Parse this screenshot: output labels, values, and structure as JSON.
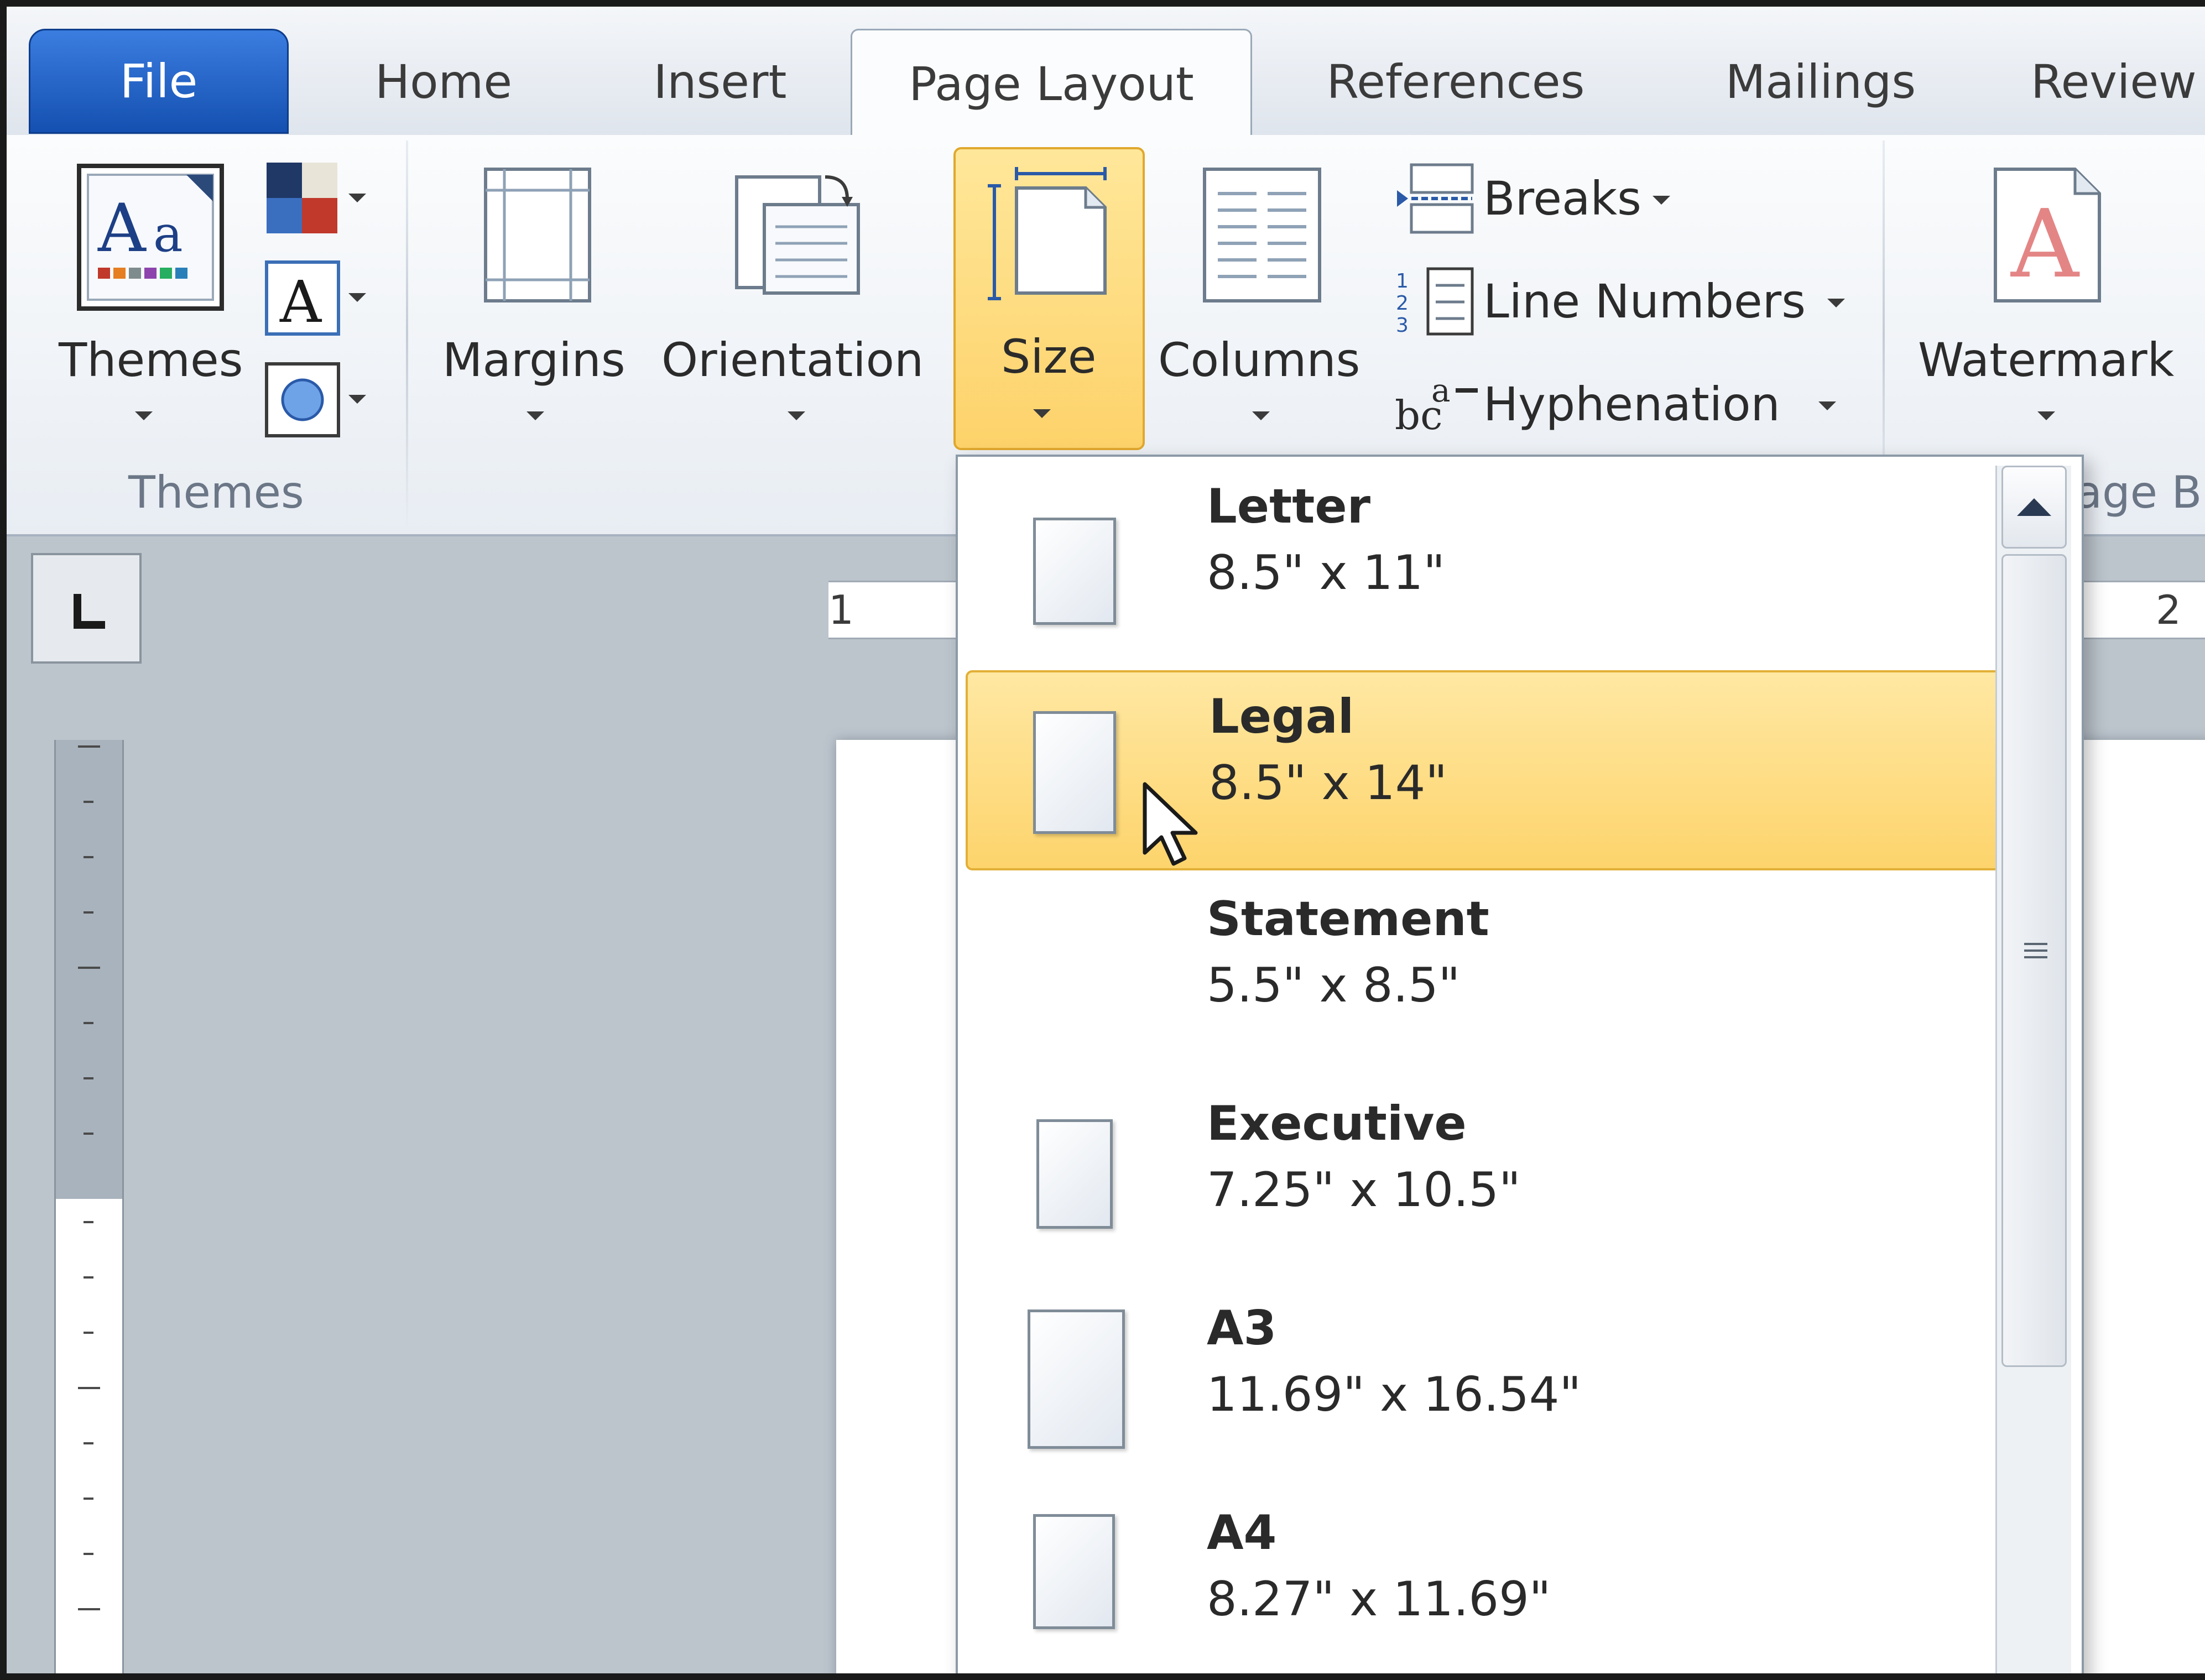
{
  "tabs": {
    "file": "File",
    "home": "Home",
    "insert": "Insert",
    "page_layout": "Page Layout",
    "references": "References",
    "mailings": "Mailings",
    "review": "Review"
  },
  "ribbon": {
    "themes_button": "Themes",
    "themes_group": "Themes",
    "margins": "Margins",
    "orientation": "Orientation",
    "size": "Size",
    "columns": "Columns",
    "breaks": "Breaks",
    "line_numbers": "Line Numbers",
    "hyphenation": "Hyphenation",
    "watermark": "Watermark",
    "page_background_group_partial": "age B"
  },
  "ruler": {
    "h_mark_left": "1",
    "h_mark_right": "2"
  },
  "size_menu": {
    "items": [
      {
        "name": "Letter",
        "dims": "8.5\" x 11\""
      },
      {
        "name": "Legal",
        "dims": "8.5\" x 14\"",
        "highlighted": true
      },
      {
        "name": "Statement",
        "dims": "5.5\" x 8.5\""
      },
      {
        "name": "Executive",
        "dims": "7.25\" x 10.5\""
      },
      {
        "name": "A3",
        "dims": "11.69\" x 16.54\""
      },
      {
        "name": "A4",
        "dims": "8.27\" x 11.69\""
      }
    ]
  },
  "colors": {
    "file_tab": "#1a5cc0",
    "highlight": "#fdd46c",
    "highlight_border": "#e2b038"
  }
}
